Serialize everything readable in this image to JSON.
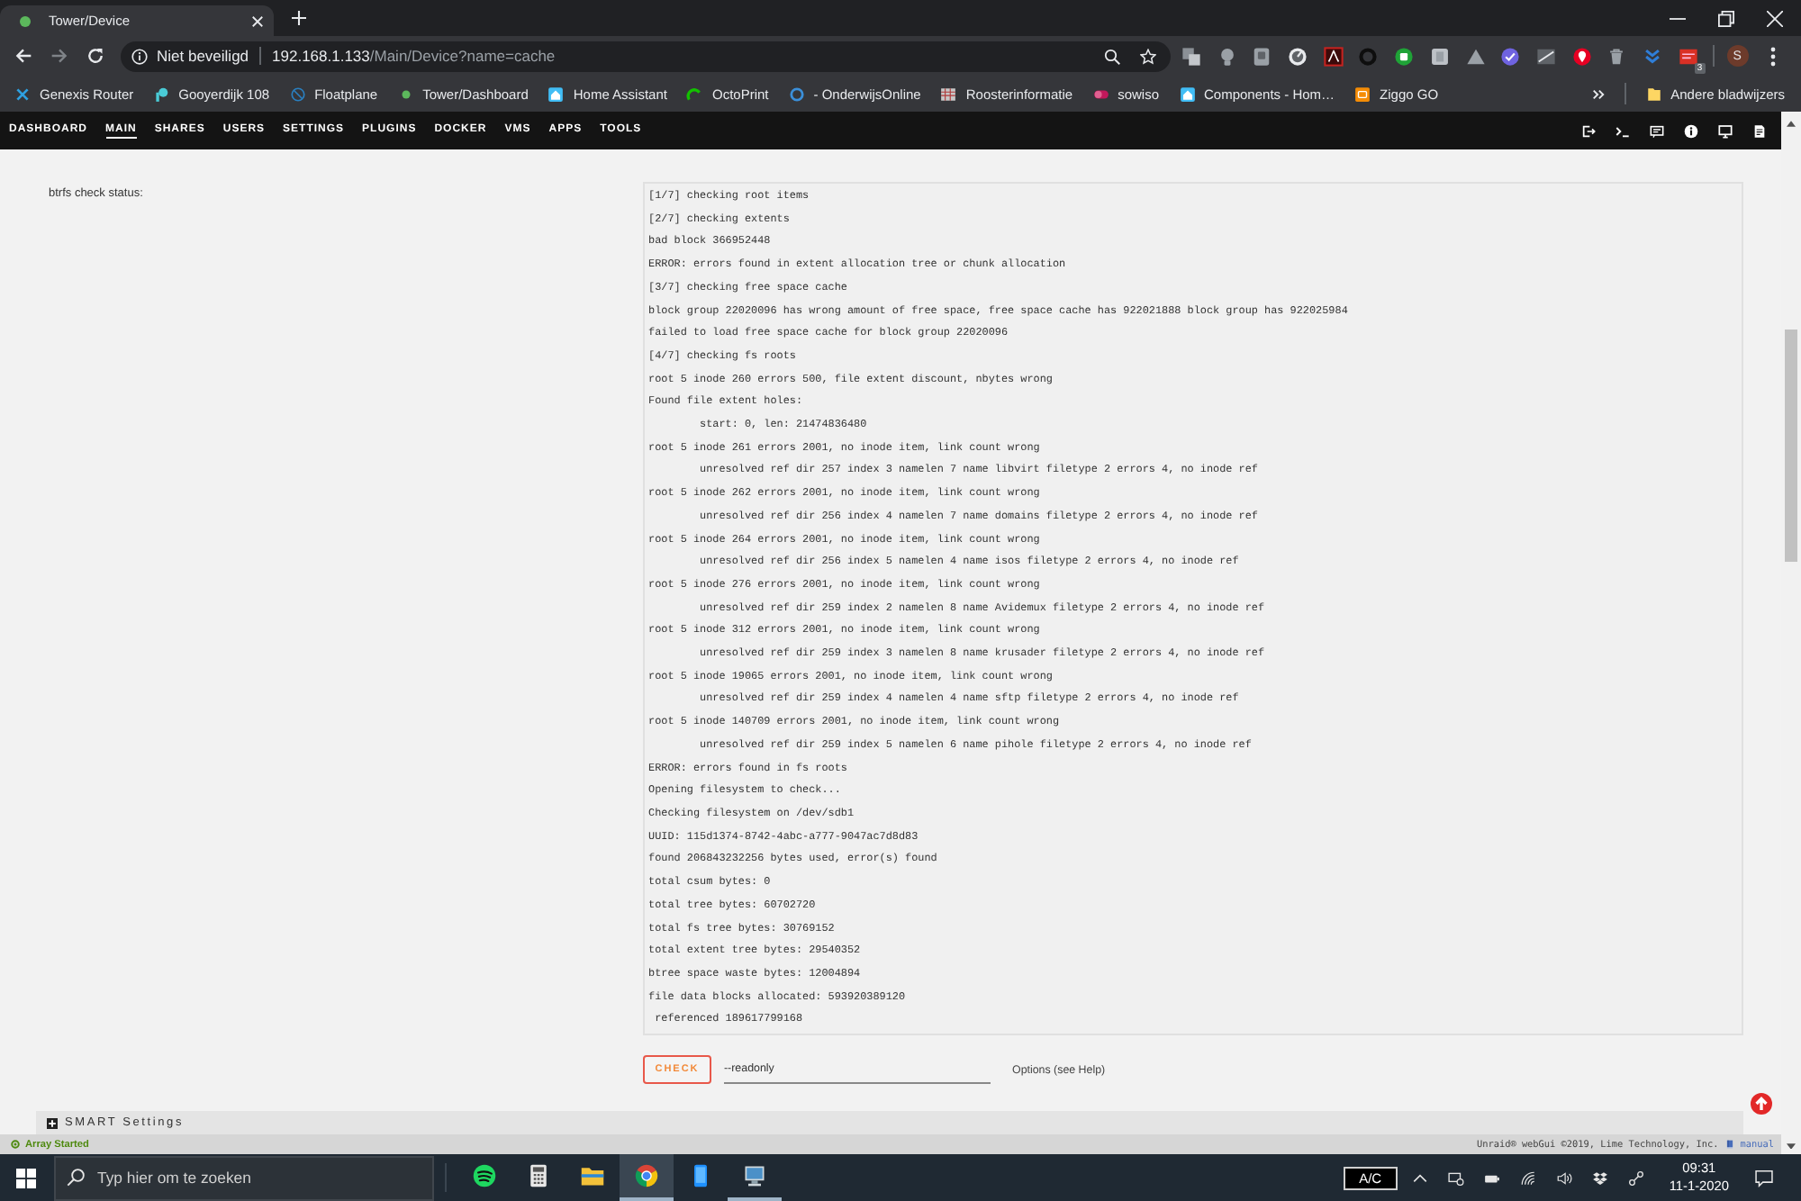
{
  "browser": {
    "tab": {
      "title": "Tower/Device"
    },
    "address_bar": {
      "security_label": "Niet beveiligd",
      "host": "192.168.1.133",
      "path": "/Main/Device?name=cache"
    },
    "extension_badge": "3",
    "profile_initial": "S",
    "bookmarks": [
      {
        "label": "Genexis Router"
      },
      {
        "label": "Gooyerdijk 108"
      },
      {
        "label": "Floatplane"
      },
      {
        "label": "Tower/Dashboard"
      },
      {
        "label": "Home Assistant"
      },
      {
        "label": "OctoPrint"
      },
      {
        "label": "- OnderwijsOnline"
      },
      {
        "label": "Roosterinformatie"
      },
      {
        "label": "sowiso"
      },
      {
        "label": "Components - Hom…"
      },
      {
        "label": "Ziggo GO"
      }
    ],
    "other_bookmarks": "Andere bladwijzers"
  },
  "nav": {
    "items": [
      {
        "label": "DASHBOARD",
        "selected": false
      },
      {
        "label": "MAIN",
        "selected": true
      },
      {
        "label": "SHARES",
        "selected": false
      },
      {
        "label": "USERS",
        "selected": false
      },
      {
        "label": "SETTINGS",
        "selected": false
      },
      {
        "label": "PLUGINS",
        "selected": false
      },
      {
        "label": "DOCKER",
        "selected": false
      },
      {
        "label": "VMS",
        "selected": false
      },
      {
        "label": "APPS",
        "selected": false
      },
      {
        "label": "TOOLS",
        "selected": false
      }
    ]
  },
  "btrfs_check": {
    "label": "btrfs check status:",
    "log": [
      {
        "text": "[1/7] checking root items"
      },
      {
        "text": "[2/7] checking extents"
      },
      {
        "text": "bad block 366952448"
      },
      {
        "text": "ERROR: errors found in extent allocation tree or chunk allocation"
      },
      {
        "text": "[3/7] checking free space cache"
      },
      {
        "text": "block group 22020096 has wrong amount of free space, free space cache has 922021888 block group has 922025984"
      },
      {
        "text": "failed to load free space cache for block group 22020096"
      },
      {
        "text": "[4/7] checking fs roots"
      },
      {
        "text": "root 5 inode 260 errors 500, file extent discount, nbytes wrong"
      },
      {
        "text": "Found file extent holes:",
        "children": [
          {
            "text": "start: 0, len: 21474836480"
          }
        ]
      },
      {
        "text": "root 5 inode 261 errors 2001, no inode item, link count wrong",
        "children": [
          {
            "text": "unresolved ref dir 257 index 3 namelen 7 name libvirt filetype 2 errors 4, no inode ref"
          }
        ]
      },
      {
        "text": "root 5 inode 262 errors 2001, no inode item, link count wrong",
        "children": [
          {
            "text": "unresolved ref dir 256 index 4 namelen 7 name domains filetype 2 errors 4, no inode ref"
          }
        ]
      },
      {
        "text": "root 5 inode 264 errors 2001, no inode item, link count wrong",
        "children": [
          {
            "text": "unresolved ref dir 256 index 5 namelen 4 name isos filetype 2 errors 4, no inode ref"
          }
        ]
      },
      {
        "text": "root 5 inode 276 errors 2001, no inode item, link count wrong",
        "children": [
          {
            "text": "unresolved ref dir 259 index 2 namelen 8 name Avidemux filetype 2 errors 4, no inode ref"
          }
        ]
      },
      {
        "text": "root 5 inode 312 errors 2001, no inode item, link count wrong",
        "children": [
          {
            "text": "unresolved ref dir 259 index 3 namelen 8 name krusader filetype 2 errors 4, no inode ref"
          }
        ]
      },
      {
        "text": "root 5 inode 19065 errors 2001, no inode item, link count wrong",
        "children": [
          {
            "text": "unresolved ref dir 259 index 4 namelen 4 name sftp filetype 2 errors 4, no inode ref"
          }
        ]
      },
      {
        "text": "root 5 inode 140709 errors 2001, no inode item, link count wrong",
        "children": [
          {
            "text": "unresolved ref dir 259 index 5 namelen 6 name pihole filetype 2 errors 4, no inode ref"
          }
        ]
      },
      {
        "text": "ERROR: errors found in fs roots"
      },
      {
        "text": "Opening filesystem to check..."
      },
      {
        "text": "Checking filesystem on /dev/sdb1"
      },
      {
        "text": "UUID: 115d1374-8742-4abc-a777-9047ac7d8d83"
      },
      {
        "text": "found 206843232256 bytes used, error(s) found"
      },
      {
        "text": "total csum bytes: 0"
      },
      {
        "text": "total tree bytes: 60702720"
      },
      {
        "text": "total fs tree bytes: 30769152"
      },
      {
        "text": "total extent tree bytes: 29540352"
      },
      {
        "text": "btree space waste bytes: 12004894"
      },
      {
        "text": "file data blocks allocated: 593920389120"
      },
      {
        "text": " referenced 189617799168"
      }
    ],
    "check_button": "CHECK",
    "options_field": {
      "value": "--readonly"
    },
    "options_hint": "Options (see Help)"
  },
  "smart_settings": {
    "title": "SMART Settings",
    "expanded": false
  },
  "status_bar": {
    "array_status": "Array Started",
    "copyright": "Unraid® webGui ©2019, Lime Technology, Inc.",
    "manual_link": "manual"
  },
  "taskbar": {
    "search_placeholder": "Typ hier om te zoeken",
    "apps": [
      {
        "kind": "music",
        "selected": false,
        "running": false
      },
      {
        "kind": "calculator",
        "selected": false,
        "running": false
      },
      {
        "kind": "files",
        "selected": false,
        "running": false
      },
      {
        "kind": "browser",
        "selected": true,
        "running": true
      },
      {
        "kind": "phone",
        "selected": false,
        "running": false
      },
      {
        "kind": "display",
        "selected": false,
        "running": true
      }
    ],
    "keyboard_layout": "A/C",
    "time": "09:31",
    "date": "11-1-2020"
  }
}
